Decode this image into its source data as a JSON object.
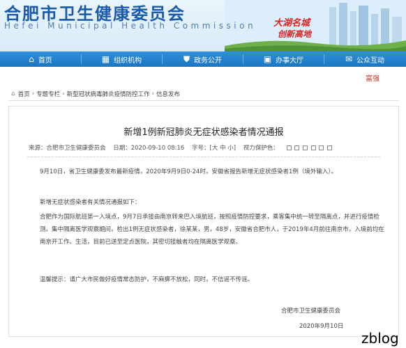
{
  "header": {
    "title_cn": "合肥市卫生健康委员会",
    "title_en": "Hefei Municipal Health Commission",
    "slogan1": "大湖名城",
    "slogan2": "创新高地"
  },
  "nav": {
    "items": [
      {
        "label": "首页",
        "icon": "home-icon"
      },
      {
        "label": "组织机构",
        "icon": "org-icon"
      },
      {
        "label": "政务公开",
        "icon": "shield-icon"
      },
      {
        "label": "办事大厅",
        "icon": "briefcase-icon"
      },
      {
        "label": "公众互动",
        "icon": "chat-icon"
      }
    ],
    "color_start": "#2f8fda",
    "color_end": "#1c76c2"
  },
  "accessibility_link": "富强",
  "breadcrumb": [
    "首页",
    "专题专栏",
    "新型冠状病毒肺炎疫情防控工作",
    "信息发布"
  ],
  "article": {
    "title": "新增1例新冠肺炎无症状感染者情况通报",
    "meta": {
      "source": "来源：合肥市卫生健康委员会",
      "date": "日期：2020-09-10 08:16",
      "font_size": "字号：[大 中 小]",
      "eye_care": "视力保护色："
    },
    "paragraphs": [
      "9月10日，省卫生健康委发布最新疫情，2020年9月9日0-24时，安徽省报告新增无症状感染者1例（境外输入）。",
      "新增无症状感染者有关情况通报如下：",
      "合肥作为国际航班第一入境点，9月7日承接由南京转来巴入境航班，按照疫情防控要求，乘客集中统一转至隔离点，并进行疫情检测。集中隔离医学观察期间，检出1例无症状感染者，徐某某，男，48岁，安徽省合肥市人，于2019年4月前往南京市，入境前均在南京开工作、生活，目前已送至定点医院，其密切接触者均在隔离医学观察。",
      "温馨提示：请广大市民做好疫情常态防护，不麻痹不放松，同时，不信谣不传谣。"
    ],
    "signature": "合肥市卫生健康委员会",
    "sign_date": "2020年9月10日"
  },
  "watermark": "zblog"
}
